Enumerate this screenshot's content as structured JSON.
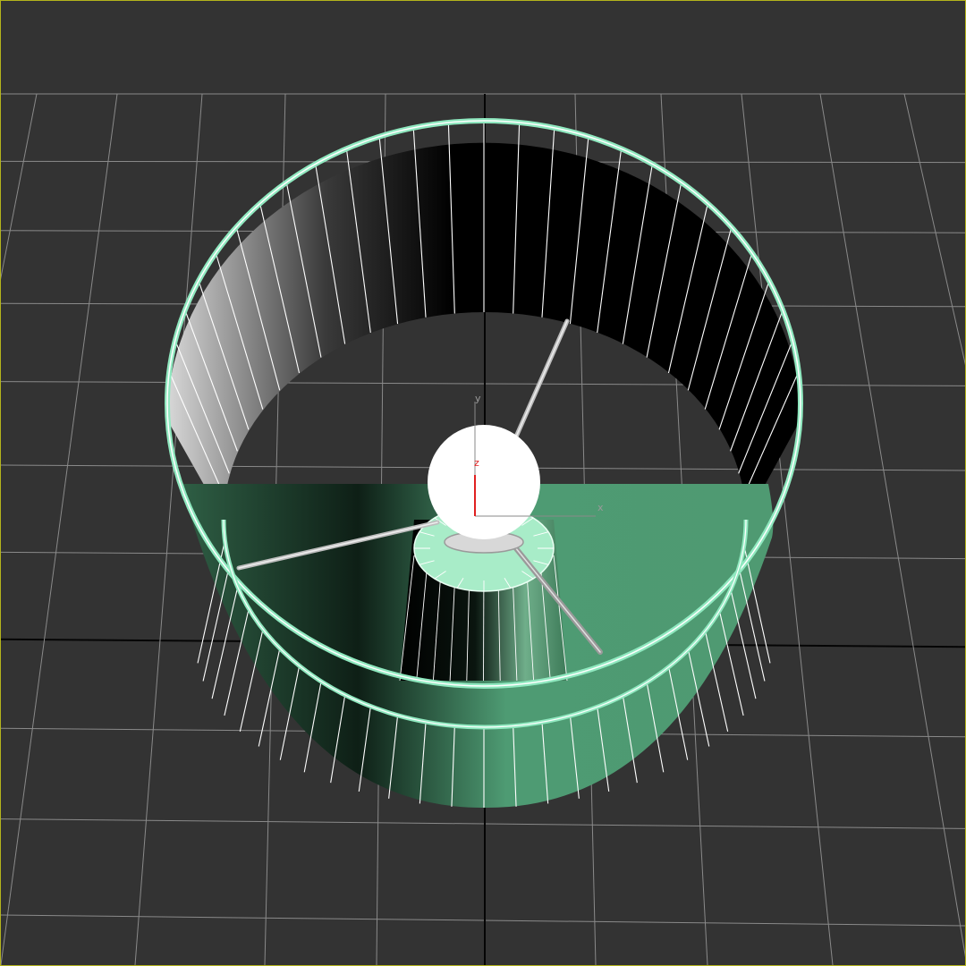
{
  "viewport": {
    "selection_border_color": "#b4b41c",
    "background_color": "#333333",
    "grid_color": "#8a8a8a",
    "grid_axis_color": "#050505"
  },
  "model": {
    "selected": true,
    "selection_wire_color": "#8fe8bf",
    "shade_color": "#4f9a72",
    "wire_color": "#ffffff",
    "bulb_color": "#ffffff"
  },
  "gizmo": {
    "x_label": "x",
    "y_label": "y",
    "z_label": "z",
    "z_color": "#e02020"
  }
}
